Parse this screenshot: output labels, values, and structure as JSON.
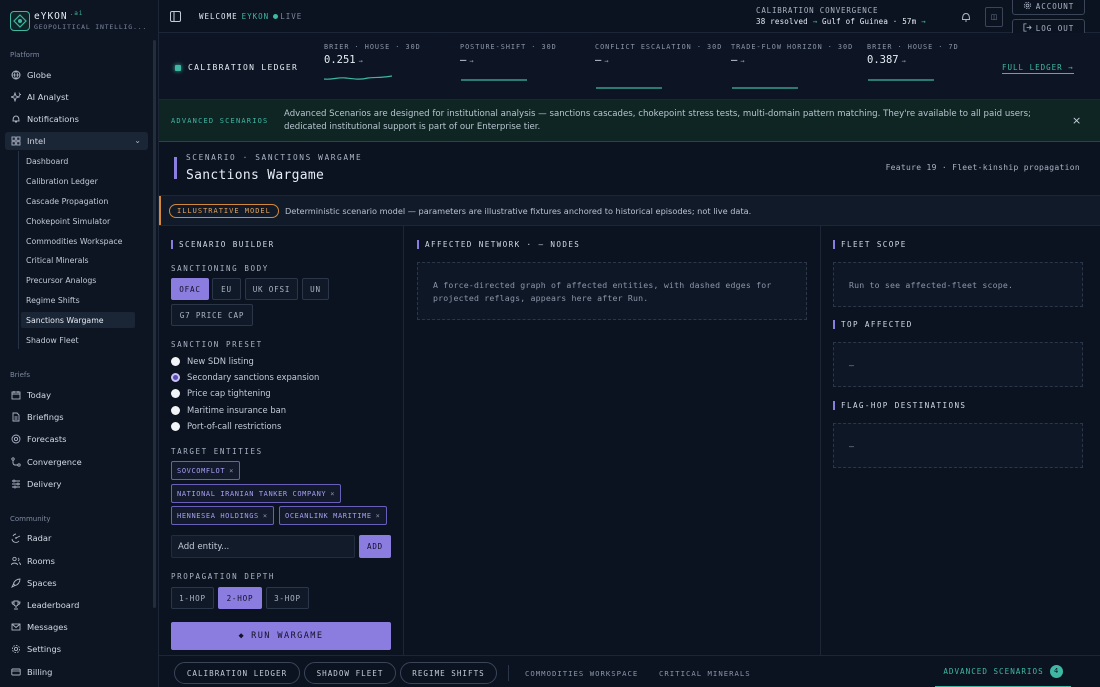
{
  "brand": {
    "name": "eYKON",
    "suffix": ".ai",
    "tagline": "GEOPOLITICAL INTELLIG..."
  },
  "sidebar": {
    "platform_label": "Platform",
    "platform": [
      "Globe",
      "AI Analyst",
      "Notifications"
    ],
    "intel_label": "Intel",
    "intel_items": [
      "Dashboard",
      "Calibration Ledger",
      "Cascade Propagation",
      "Chokepoint Simulator",
      "Commodities Workspace",
      "Critical Minerals",
      "Precursor Analogs",
      "Regime Shifts",
      "Sanctions Wargame",
      "Shadow Fleet"
    ],
    "briefs_label": "Briefs",
    "briefs": [
      "Today",
      "Briefings",
      "Forecasts",
      "Convergence",
      "Delivery"
    ],
    "community_label": "Community",
    "community": [
      "Radar",
      "Rooms",
      "Spaces",
      "Leaderboard",
      "Messages",
      "Settings",
      "Billing"
    ]
  },
  "topbar": {
    "welcome": "WELCOME",
    "user": "EYKON",
    "live": "LIVE",
    "cal_title": "CALIBRATION  CONVERGENCE",
    "cal_resolved": "38 resolved",
    "cal_place": "Gulf of Guinea · 57m",
    "account": "ACCOUNT",
    "logout": "LOG OUT"
  },
  "ledger": {
    "title": "CALIBRATION LEDGER",
    "metrics": [
      {
        "label": "BRIER · HOUSE · 30D",
        "value": "0.251",
        "trend": "→"
      },
      {
        "label": "POSTURE-SHIFT · 30D",
        "value": "—",
        "trend": "→"
      },
      {
        "label": "CONFLICT ESCALATION · 30D",
        "value": "—",
        "trend": "→"
      },
      {
        "label": "TRADE-FLOW HORIZON · 30D",
        "value": "—",
        "trend": "→"
      },
      {
        "label": "BRIER · HOUSE · 7D",
        "value": "0.387",
        "trend": "→"
      }
    ],
    "full_link": "FULL LEDGER →"
  },
  "banner": {
    "tag": "ADVANCED SCENARIOS",
    "text": "Advanced Scenarios are designed for institutional analysis — sanctions cascades, chokepoint stress tests, multi-domain pattern matching. They're available to all paid users; dedicated institutional support is part of our Enterprise tier.",
    "close": "×"
  },
  "scenario": {
    "kicker": "SCENARIO · SANCTIONS WARGAME",
    "title": "Sanctions Wargame",
    "feature": "Feature 19 · Fleet-kinship propagation"
  },
  "illustrative": {
    "pill": "ILLUSTRATIVE MODEL",
    "text": "Deterministic scenario model — parameters are illustrative fixtures anchored to historical episodes; not live data."
  },
  "builder": {
    "title": "SCENARIO BUILDER",
    "body_label": "SANCTIONING BODY",
    "bodies": [
      "OFAC",
      "EU",
      "UK OFSI",
      "UN",
      "G7 PRICE CAP"
    ],
    "preset_label": "SANCTION PRESET",
    "presets": [
      "New SDN listing",
      "Secondary sanctions expansion",
      "Price cap tightening",
      "Maritime insurance ban",
      "Port-of-call restrictions"
    ],
    "entities_label": "TARGET ENTITIES",
    "entities": [
      "SOVCOMFLOT",
      "NATIONAL IRANIAN TANKER COMPANY",
      "HENNESEA HOLDINGS",
      "OCEANLINK MARITIME"
    ],
    "tag_remove": "×",
    "entity_placeholder": "Add entity...",
    "add": "ADD",
    "depth_label": "PROPAGATION DEPTH",
    "depths": [
      "1-HOP",
      "2-HOP",
      "3-HOP"
    ],
    "run": "RUN WARGAME",
    "run_icon": "◆"
  },
  "network": {
    "title": "AFFECTED NETWORK · — NODES",
    "placeholder": "A force-directed graph of affected entities, with dashed edges for projected reflags, appears here after Run."
  },
  "scope": {
    "fleet_title": "FLEET SCOPE",
    "fleet_text": "Run to see affected-fleet scope.",
    "top_title": "TOP AFFECTED",
    "top_text": "—",
    "flag_title": "FLAG-HOP DESTINATIONS",
    "flag_text": "—"
  },
  "bottom": {
    "tabs": [
      "CALIBRATION LEDGER",
      "SHADOW FLEET",
      "REGIME SHIFTS"
    ],
    "links": [
      "COMMODITIES WORKSPACE",
      "CRITICAL MINERALS"
    ],
    "advanced": "ADVANCED SCENARIOS",
    "advanced_count": "4"
  },
  "colors": {
    "accent_teal": "#3fb8a3",
    "accent_purple": "#8b7ce0",
    "warning": "#d38a3c",
    "bg": "#0b1220"
  }
}
